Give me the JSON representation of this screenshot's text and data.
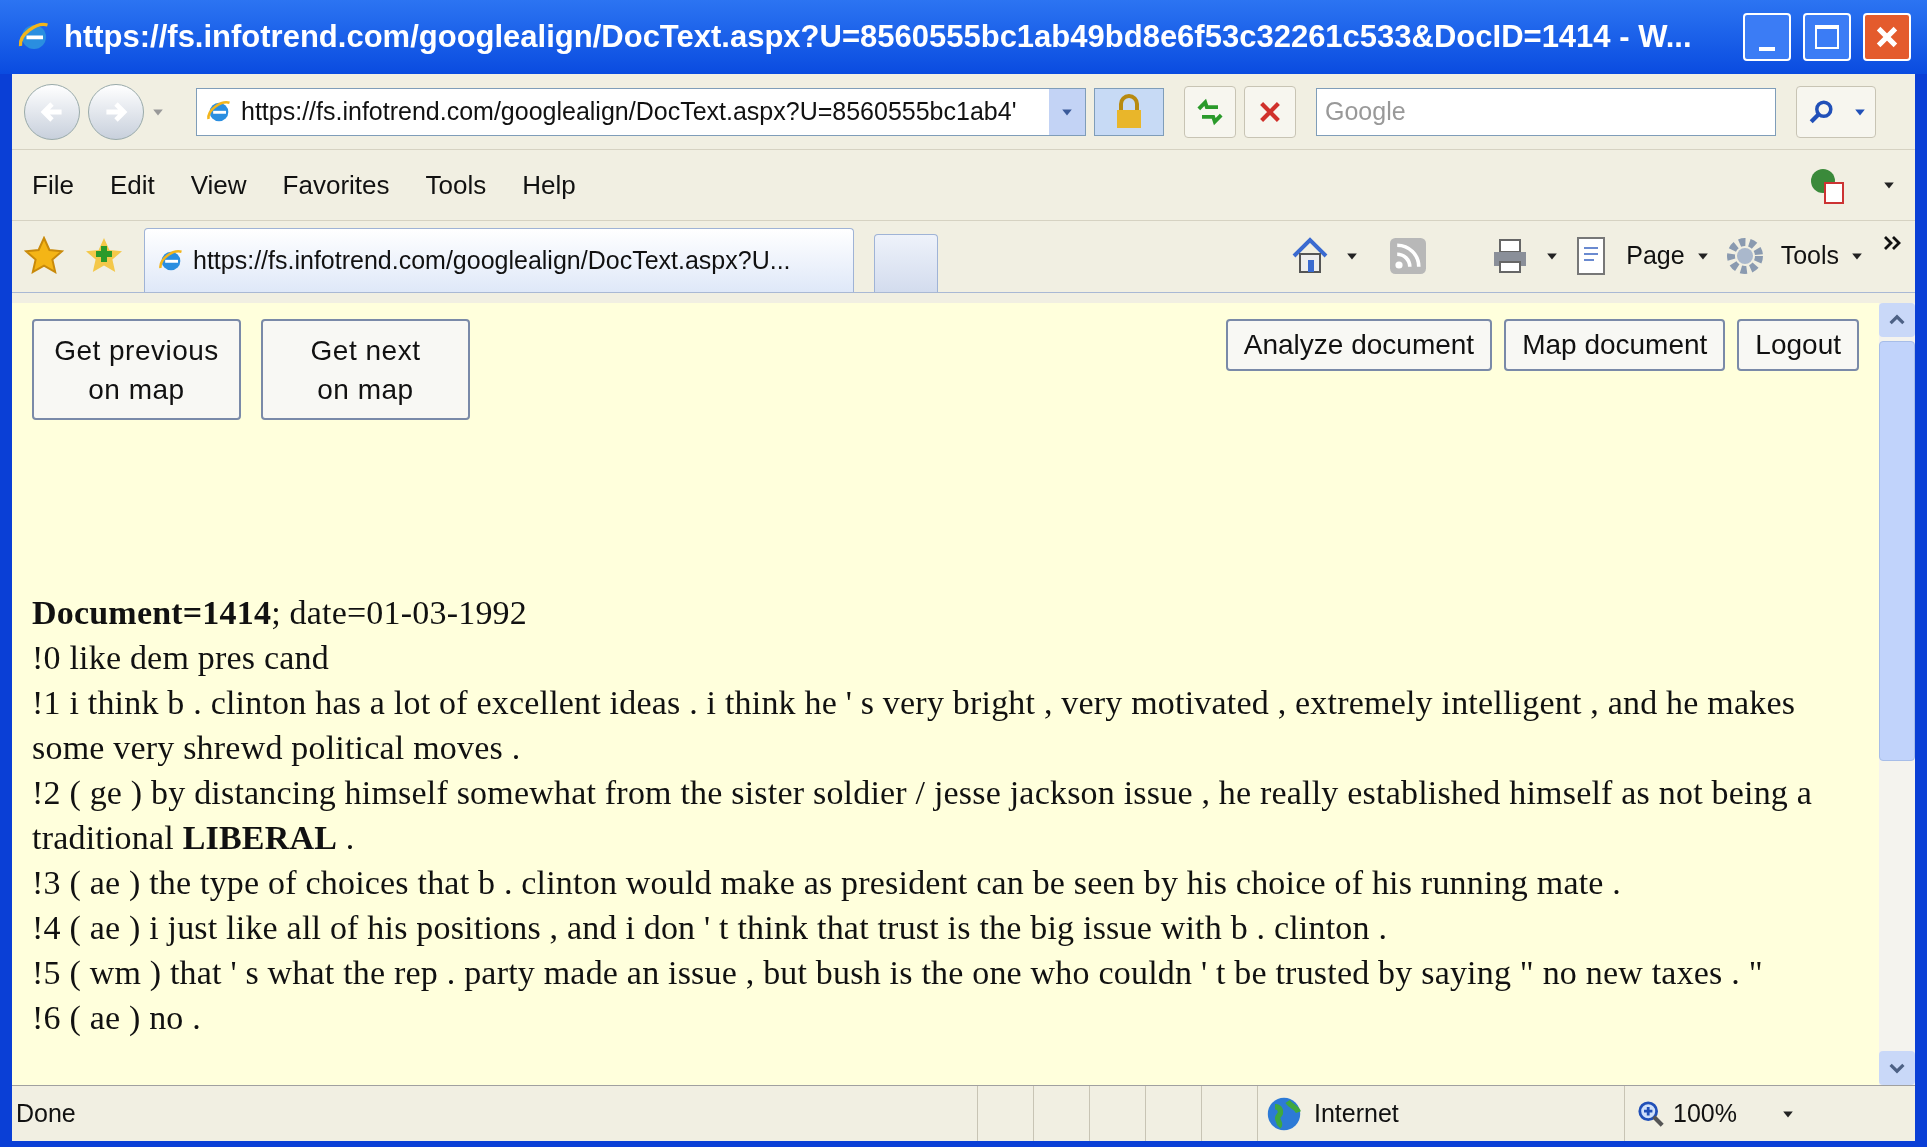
{
  "window": {
    "title": "https://fs.infotrend.com/googlealign/DocText.aspx?U=8560555bc1ab49bd8e6f53c32261c533&DocID=1414 - W..."
  },
  "address_bar": {
    "url": "https://fs.infotrend.com/googlealign/DocText.aspx?U=8560555bc1ab4'"
  },
  "search": {
    "placeholder": "Google"
  },
  "menu": [
    "File",
    "Edit",
    "View",
    "Favorites",
    "Tools",
    "Help"
  ],
  "tabs": [
    {
      "label": "https://fs.infotrend.com/googlealign/DocText.aspx?U...",
      "selected": true
    }
  ],
  "command_bar": {
    "page": "Page",
    "tools": "Tools"
  },
  "page": {
    "left_buttons": [
      "Get previous on map",
      "Get next on map"
    ],
    "right_buttons": [
      "Analyze document",
      "Map document",
      "Logout"
    ],
    "heading": "**Document=1414**; date=01-03-1992",
    "lines": [
      "!0 like dem pres cand",
      "!1 i think b . clinton has a lot of excellent ideas . i think he ' s very bright , very motivated , extremely intelligent , and he makes some very shrewd political moves .",
      "!2 ( ge ) by distancing himself somewhat from the sister soldier / jesse jackson issue , he really established himself as not being a traditional **LIBERAL** .",
      "!3 ( ae ) the type of choices that b . clinton would make as president can be seen by his choice of his running mate .",
      "!4 ( ae ) i just like all of his positions , and i don ' t think that trust is the big issue with b . clinton .",
      "!5 ( wm ) that ' s what the rep . party made an issue , but bush is the one who couldn ' t be trusted by saying \" no new taxes . \"",
      "!6 ( ae ) no ."
    ]
  },
  "status_bar": {
    "status": "Done",
    "zone": "Internet",
    "zoom": "100%"
  }
}
